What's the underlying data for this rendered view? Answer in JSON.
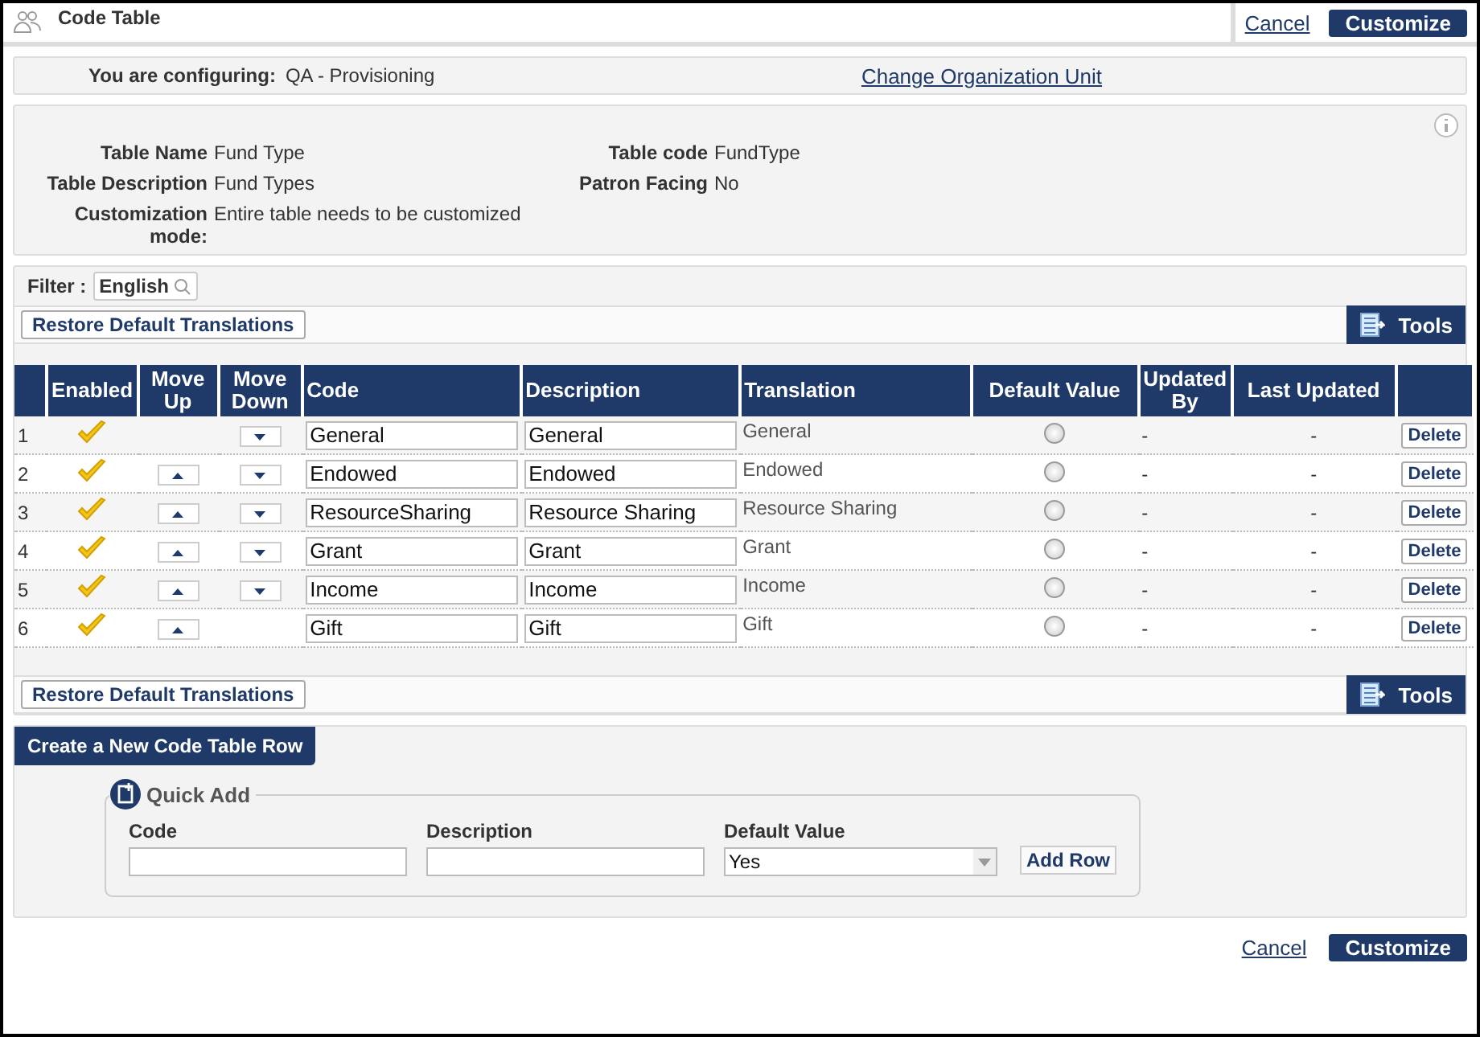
{
  "header": {
    "title": "Code Table",
    "cancel": "Cancel",
    "customize": "Customize"
  },
  "config": {
    "label": "You are configuring:",
    "value": "QA - Provisioning",
    "change_link": "Change Organization Unit"
  },
  "details": [
    {
      "label": "Table Name",
      "value": "Fund Type"
    },
    {
      "label": "Table code",
      "value": "FundType"
    },
    {
      "label": "Table Description",
      "value": "Fund Types"
    },
    {
      "label": "Patron Facing",
      "value": "No"
    },
    {
      "label": "Customization mode:",
      "value": "Entire table needs to be customized"
    }
  ],
  "filter": {
    "label": "Filter :",
    "value": "English"
  },
  "restore_button": "Restore Default Translations",
  "tools_button": "Tools",
  "table": {
    "columns": [
      "Enabled",
      "Move Up",
      "Move Down",
      "Code",
      "Description",
      "Translation",
      "Default Value",
      "Updated By",
      "Last Updated"
    ],
    "rows": [
      {
        "number": "1",
        "enabled": true,
        "move_up": false,
        "move_down": true,
        "code": "General",
        "description": "General",
        "translation": "General",
        "default": false,
        "updated_by": "-",
        "last_updated": "-",
        "action": "Delete"
      },
      {
        "number": "2",
        "enabled": true,
        "move_up": true,
        "move_down": true,
        "code": "Endowed",
        "description": "Endowed",
        "translation": "Endowed",
        "default": false,
        "updated_by": "-",
        "last_updated": "-",
        "action": "Delete"
      },
      {
        "number": "3",
        "enabled": true,
        "move_up": true,
        "move_down": true,
        "code": "ResourceSharing",
        "description": "Resource Sharing",
        "translation": "Resource Sharing",
        "default": false,
        "updated_by": "-",
        "last_updated": "-",
        "action": "Delete"
      },
      {
        "number": "4",
        "enabled": true,
        "move_up": true,
        "move_down": true,
        "code": "Grant",
        "description": "Grant",
        "translation": "Grant",
        "default": false,
        "updated_by": "-",
        "last_updated": "-",
        "action": "Delete"
      },
      {
        "number": "5",
        "enabled": true,
        "move_up": true,
        "move_down": true,
        "code": "Income",
        "description": "Income",
        "translation": "Income",
        "default": false,
        "updated_by": "-",
        "last_updated": "-",
        "action": "Delete"
      },
      {
        "number": "6",
        "enabled": true,
        "move_up": true,
        "move_down": false,
        "code": "Gift",
        "description": "Gift",
        "translation": "Gift",
        "default": false,
        "updated_by": "-",
        "last_updated": "-",
        "action": "Delete"
      }
    ]
  },
  "restore_button_bottom": "Restore Default Translations",
  "tools_button_bottom": "Tools",
  "create_tab": "Create a New Code Table Row",
  "quick_add": {
    "title": "Quick Add",
    "fields": [
      {
        "label": "Code",
        "kind": "text"
      },
      {
        "label": "Description",
        "kind": "text"
      },
      {
        "label": "Default Value",
        "kind": "select",
        "value": "Yes"
      }
    ],
    "add_button": "Add Row"
  },
  "footer": {
    "cancel": "Cancel",
    "customize": "Customize"
  }
}
